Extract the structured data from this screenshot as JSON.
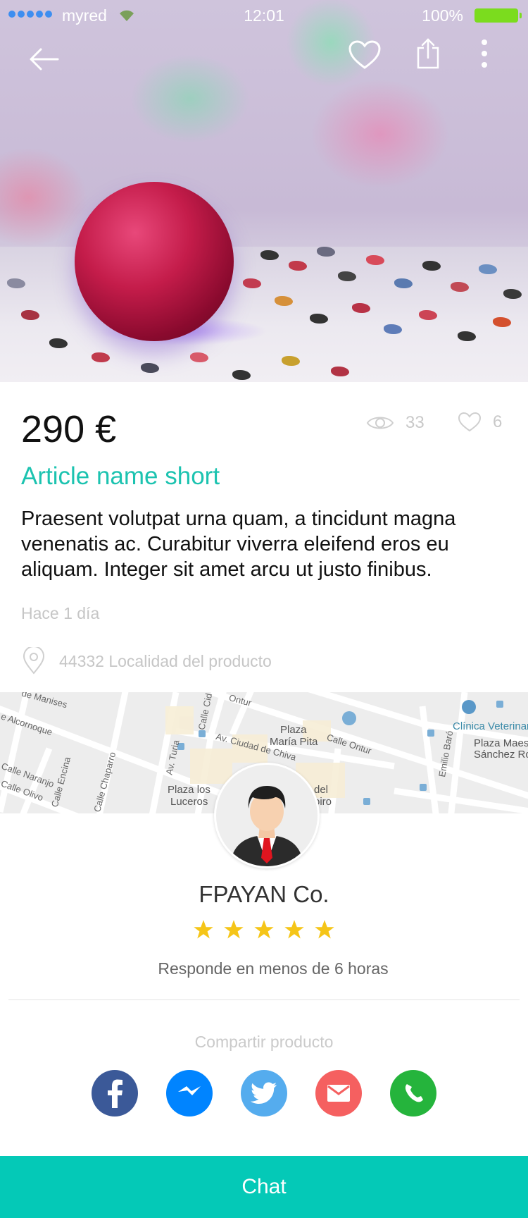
{
  "status_bar": {
    "carrier": "myred",
    "time": "12:01",
    "battery": "100%"
  },
  "header": {
    "back_icon": "arrow-left-icon",
    "favorite_icon": "heart-icon",
    "share_icon": "share-icon",
    "more_icon": "more-vertical-icon"
  },
  "product": {
    "price": "290 €",
    "views": "33",
    "likes": "6",
    "title": "Article name short",
    "description": "Praesent volutpat urna quam, a tincidunt magna venenatis ac. Curabitur viverra eleifend eros eu aliquam. Integer sit amet arcu ut justo finibus.",
    "posted": "Hace 1 día",
    "location": "44332 Localidad del producto"
  },
  "map": {
    "labels": {
      "manises": "de Manises",
      "alcornoque": "e Alcornoque",
      "naranjo": "Calle Naranjo",
      "olivo": "Calle Olivo",
      "encina": "Calle Encina",
      "chaparro": "Calle Chaparro",
      "turia": "Av. Turia",
      "ciudad_chiva": "Av. Ciudad de Chiva",
      "ontur": "Calle Ontur",
      "ontur2": "Ontur",
      "calle_c": "Calle Cid",
      "plaza_maria_pita_1": "Plaza",
      "plaza_maria_pita_2": "María Pita",
      "plaza_luceros_1": "Plaza los",
      "plaza_luceros_2": "Luceros",
      "del": "del",
      "oiro": "oiro",
      "emilio_baro": "Emilio Baró",
      "clinica": "Clínica Veterinari",
      "plaza_maestro_1": "Plaza Maest",
      "plaza_maestro_2": "Sánchez Ros"
    }
  },
  "seller": {
    "name": "FPAYAN Co.",
    "rating": 5,
    "rating_max": 5,
    "response": "Responde en menos de 6 horas"
  },
  "share": {
    "title": "Compartir producto",
    "networks": [
      "facebook",
      "messenger",
      "twitter",
      "email",
      "whatsapp"
    ],
    "colors": {
      "facebook": "#3b5998",
      "messenger": "#0084ff",
      "twitter": "#55acee",
      "email": "#f56060",
      "whatsapp": "#25b43c"
    }
  },
  "chat_button": {
    "label": "Chat"
  },
  "colors": {
    "accent": "#1cc3b0",
    "chat_bar": "#04c9b7",
    "star": "#f5c518"
  }
}
